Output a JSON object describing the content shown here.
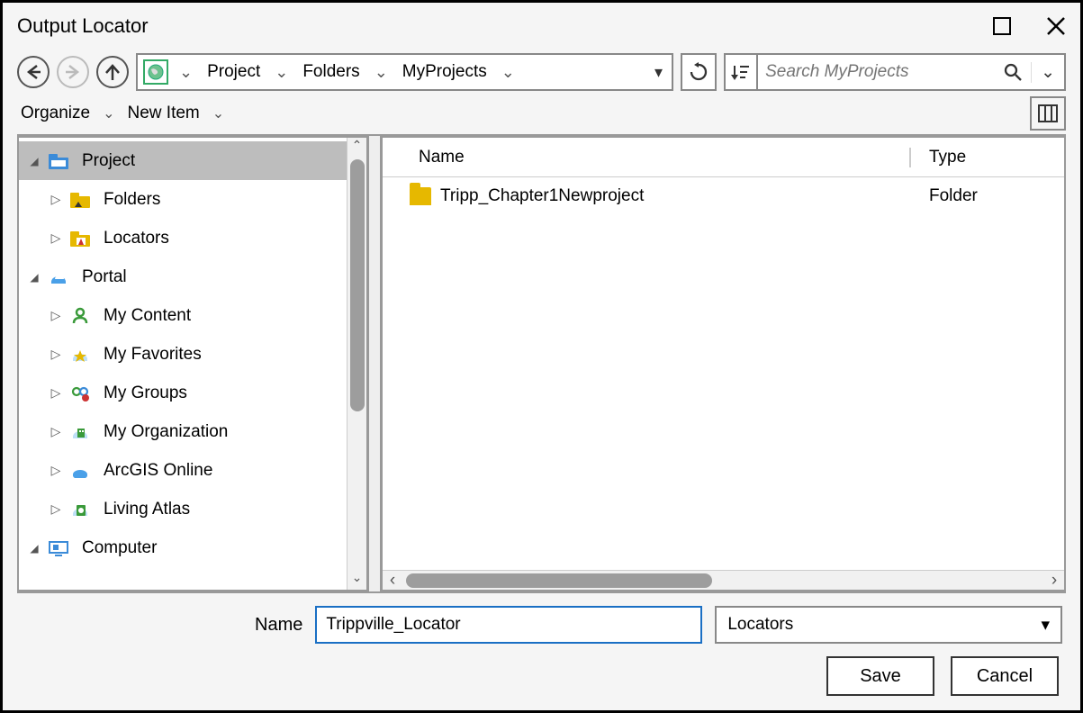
{
  "window": {
    "title": "Output Locator"
  },
  "breadcrumb": {
    "items": [
      "Project",
      "Folders",
      "MyProjects"
    ]
  },
  "search": {
    "placeholder": "Search MyProjects"
  },
  "toolbar2": {
    "organize": "Organize",
    "new_item": "New Item"
  },
  "tree": {
    "items": [
      {
        "label": "Project",
        "level": 0,
        "expander": "down",
        "icon": "project",
        "selected": true
      },
      {
        "label": "Folders",
        "level": 1,
        "expander": "right",
        "icon": "folders"
      },
      {
        "label": "Locators",
        "level": 1,
        "expander": "right",
        "icon": "locators"
      },
      {
        "label": "Portal",
        "level": 0,
        "expander": "down",
        "icon": "portal"
      },
      {
        "label": "My Content",
        "level": 1,
        "expander": "right",
        "icon": "mycontent"
      },
      {
        "label": "My Favorites",
        "level": 1,
        "expander": "right",
        "icon": "myfavorites"
      },
      {
        "label": "My Groups",
        "level": 1,
        "expander": "right",
        "icon": "mygroups"
      },
      {
        "label": "My Organization",
        "level": 1,
        "expander": "right",
        "icon": "myorg"
      },
      {
        "label": "ArcGIS Online",
        "level": 1,
        "expander": "right",
        "icon": "agol"
      },
      {
        "label": "Living Atlas",
        "level": 1,
        "expander": "right",
        "icon": "atlas"
      },
      {
        "label": "Computer",
        "level": 0,
        "expander": "down",
        "icon": "computer"
      }
    ]
  },
  "list": {
    "columns": {
      "name": "Name",
      "type": "Type"
    },
    "rows": [
      {
        "name": "Tripp_Chapter1Newproject",
        "type": "Folder"
      }
    ]
  },
  "footer": {
    "name_label": "Name",
    "name_value": "Trippville_Locator",
    "type_value": "Locators",
    "save": "Save",
    "cancel": "Cancel"
  }
}
